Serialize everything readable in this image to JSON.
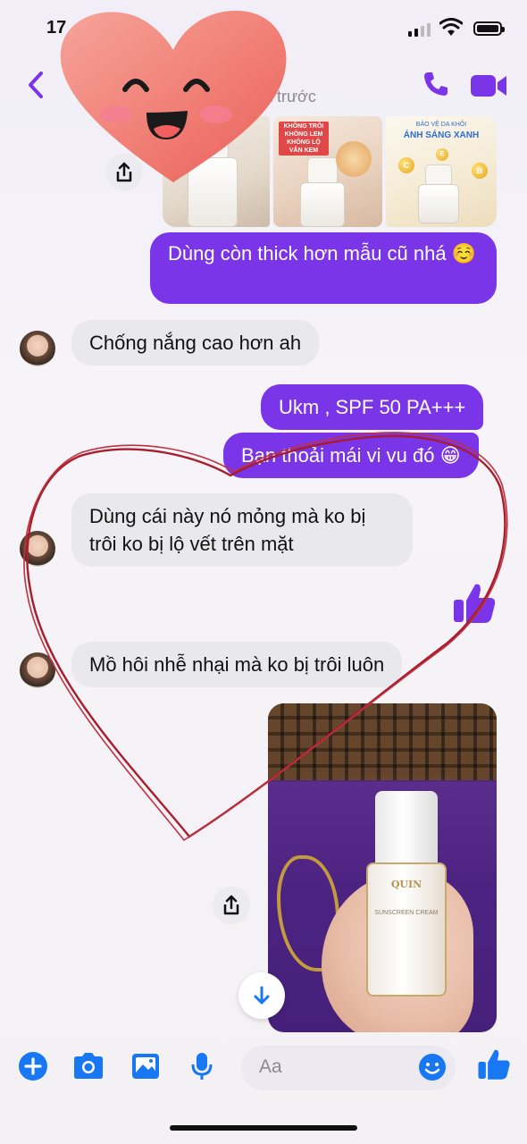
{
  "status_bar": {
    "time": "17"
  },
  "header": {
    "subtitle": "t trước"
  },
  "thumbnails": [
    {
      "caption": ""
    },
    {
      "tag_lines": [
        "KHÔNG TRÔI",
        "KHÔNG LEM",
        "KHÔNG LỘ VÂN KEM"
      ]
    },
    {
      "tag_top": "BẢO VỆ DA KHỎI",
      "tag_main": "ÁNH SÁNG XANH"
    }
  ],
  "messages": [
    {
      "side": "out",
      "text": "Dùng còn thick hơn mẫu cũ nhá ☺️"
    },
    {
      "side": "in",
      "text": "Chống nắng cao hơn ah"
    },
    {
      "side": "out",
      "text": "Ukm , SPF 50 PA+++"
    },
    {
      "side": "out",
      "text": "Bạn thoải mái vi vu đó 😁"
    },
    {
      "side": "in",
      "text": "Dùng cái này nó mỏng mà ko bị trôi ko bị lộ vết trên mặt"
    },
    {
      "side": "in",
      "text": "Mồ hôi nhễ nhại mà ko bị trôi luôn"
    }
  ],
  "product": {
    "brand": "QUIN",
    "name": "SUNSCREEN CREAM"
  },
  "composer": {
    "placeholder": "Aa"
  },
  "colors": {
    "accent": "#7a35e8",
    "icon_blue": "#1877f2",
    "outgoing_bubble": "#7a35e8",
    "incoming_bubble": "#e9e8ed"
  },
  "icons": [
    "back-icon",
    "phone-icon",
    "video-icon",
    "share-icon",
    "like-icon",
    "scroll-down-icon",
    "plus-icon",
    "camera-icon",
    "gallery-icon",
    "mic-icon",
    "emoji-icon"
  ]
}
